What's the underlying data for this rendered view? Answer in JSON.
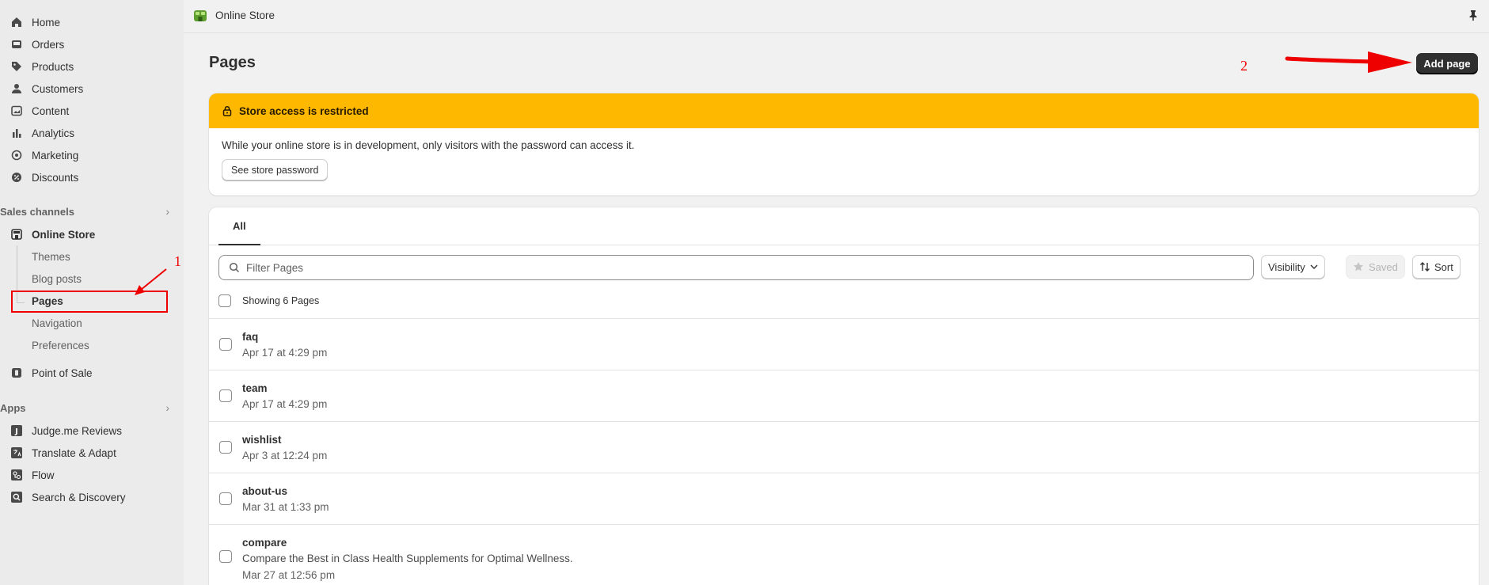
{
  "sidebar": {
    "main_items": [
      {
        "label": "Home",
        "icon": "home-icon"
      },
      {
        "label": "Orders",
        "icon": "inbox-icon"
      },
      {
        "label": "Products",
        "icon": "tag-icon"
      },
      {
        "label": "Customers",
        "icon": "person-icon"
      },
      {
        "label": "Content",
        "icon": "image-icon"
      },
      {
        "label": "Analytics",
        "icon": "bar-chart-icon"
      },
      {
        "label": "Marketing",
        "icon": "target-icon"
      },
      {
        "label": "Discounts",
        "icon": "discount-icon"
      }
    ],
    "sales_channels_heading": "Sales channels",
    "online_store_label": "Online Store",
    "online_store_sub": [
      "Themes",
      "Blog posts",
      "Pages",
      "Navigation",
      "Preferences"
    ],
    "point_of_sale_label": "Point of Sale",
    "apps_heading": "Apps",
    "apps": [
      {
        "label": "Judge.me Reviews",
        "icon": "judgeme-icon"
      },
      {
        "label": "Translate & Adapt",
        "icon": "translate-icon"
      },
      {
        "label": "Flow",
        "icon": "flow-icon"
      },
      {
        "label": "Search & Discovery",
        "icon": "search-discovery-icon"
      }
    ]
  },
  "topbar": {
    "title": "Online Store"
  },
  "main": {
    "page_title": "Pages",
    "add_page_label": "Add page",
    "banner": {
      "title": "Store access is restricted",
      "message": "While your online store is in development, only visitors with the password can access it.",
      "button_label": "See store password"
    },
    "tabs": [
      "All"
    ],
    "search_placeholder": "Filter Pages",
    "visibility_label": "Visibility",
    "saved_label": "Saved",
    "sort_label": "Sort",
    "showing_text": "Showing 6 Pages",
    "pages": [
      {
        "name": "faq",
        "desc": "",
        "date": "Apr 17 at 4:29 pm"
      },
      {
        "name": "team",
        "desc": "",
        "date": "Apr 17 at 4:29 pm"
      },
      {
        "name": "wishlist",
        "desc": "",
        "date": "Apr 3 at 12:24 pm"
      },
      {
        "name": "about-us",
        "desc": "",
        "date": "Mar 31 at 1:33 pm"
      },
      {
        "name": "compare",
        "desc": "Compare the Best in Class Health Supplements for Optimal Wellness.",
        "date": "Mar 27 at 12:56 pm"
      }
    ]
  },
  "annotations": {
    "step1": "1",
    "step2": "2"
  },
  "colors": {
    "banner": "#ffb800",
    "annotation": "#ee0000",
    "primary_button": "#303030"
  }
}
